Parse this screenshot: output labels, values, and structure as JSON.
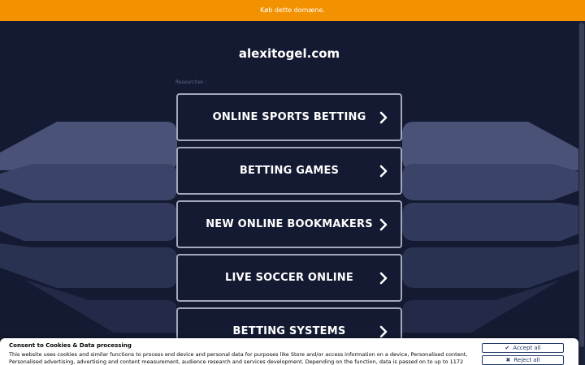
{
  "banner": {
    "text": "Køb dette domæne."
  },
  "domain": {
    "title": "alexitogel.com"
  },
  "researches_label": "Researches :",
  "links": [
    {
      "label": "ONLINE SPORTS BETTING"
    },
    {
      "label": "BETTING GAMES"
    },
    {
      "label": "NEW ONLINE BOOKMAKERS"
    },
    {
      "label": "LIVE SOCCER ONLINE"
    },
    {
      "label": "BETTING SYSTEMS"
    }
  ],
  "cookie": {
    "title": "Consent to Cookies & Data processing",
    "text": "This website uses cookies and similar functions to process end device and personal data for purposes like Store and/or access information on a device, Personalised content, Personalised advertising, advertising and content measurement, audience research and services development. Depending on the function, data is passed on to up to 1172",
    "accept_label": "Accept all",
    "reject_label": "Reject all",
    "accept_icon": "check-icon",
    "reject_icon": "x-icon"
  },
  "colors": {
    "banner": "#f39200",
    "background": "#141a31",
    "button_border": "#a4a8bd",
    "cookie_button": "#1f3a6b"
  }
}
